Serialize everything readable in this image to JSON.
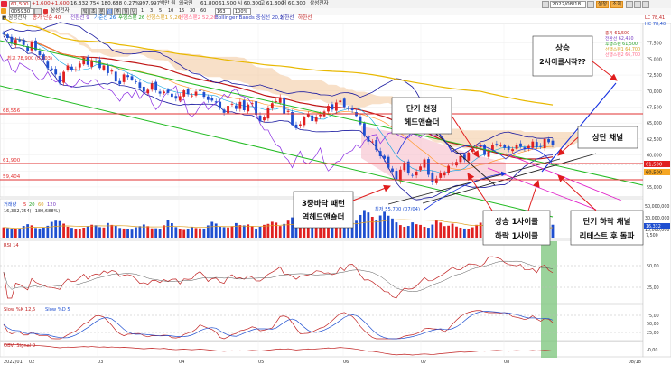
{
  "toolbar": {
    "price_cells": [
      "61,500",
      "+1,600",
      "+1,600",
      "16,332,754",
      "180,688",
      "0.27%",
      "997,997백만 원",
      "외국인",
      "61,800",
      "61,500",
      "시 60,300",
      "고 61,300",
      "저 60,300"
    ],
    "stock_name": "삼성전자",
    "code": "005930",
    "date": "2022/08/18",
    "period_tabs": [
      "틱",
      "초",
      "분",
      "일",
      "주",
      "월",
      "년"
    ],
    "numbers": [
      "1",
      "3",
      "5",
      "10",
      "15",
      "30",
      "60"
    ],
    "count": "163",
    "ratio": "100%",
    "right_buttons": [
      "설정",
      "조회"
    ],
    "legend": [
      "■ 삼성전자",
      "종가 단순 40",
      "전환선 9",
      "기준선 26",
      "후행스팬 26",
      "선행스팬1 9,26",
      "선행스팬2 52,26",
      "Bollinger Bands 중심선 20,2",
      "상한선",
      "하한선"
    ],
    "legend_colors": [
      "#3a3a3a",
      "#d21d1d",
      "#7a3fc4",
      "#0a6ae0",
      "#22a022",
      "#d8a020",
      "#ff6b8a",
      "#3040c0",
      "#1a1aa0",
      "#c02020"
    ]
  },
  "annotations": {
    "top_right_1": "상승",
    "top_right_2": "2사이클시작??",
    "mid_1": "단기 천정",
    "mid_2": "헤드앤숄더",
    "upper_channel": "상단 채널",
    "bottom_left_1": "3중바닥 패턴",
    "bottom_left_2": "역헤드앤숄더",
    "low_label": "최저 55,700 (07/04)",
    "high_label": "최고 78,900 (01/03)",
    "cycle_1": "상승 1사이클",
    "cycle_2": "하락 1사이클",
    "down_channel_1": "단기 하락 채널",
    "down_channel_2": "리테스트 후 돌파"
  },
  "y_labels_main": [
    "77,500",
    "75,000",
    "72,500",
    "70,000",
    "67,500",
    "65,000",
    "62,500",
    "60,000",
    "57,500",
    "55,000"
  ],
  "h_line_labels": [
    "68,556",
    "61,900",
    "59,404"
  ],
  "h_line_colors": [
    "#e23030",
    "#e23030",
    "#e23030"
  ],
  "current_price_label": "61,500",
  "current_price_label_2": "60,500",
  "right_top_labels": [
    "LC 78,41",
    "HC 78,40"
  ],
  "right_side_values": [
    "종가 61,500",
    "전환선 62,450",
    "후행스팬 61,500",
    "선행스팬1 64,700",
    "선행스팬2 66,700"
  ],
  "x_labels": [
    "2022/01",
    "02",
    "03",
    "04",
    "05",
    "06",
    "07",
    "08",
    "08/18"
  ],
  "volume": {
    "title": "거래량",
    "legend": [
      "5",
      "20",
      "60",
      "120"
    ],
    "info": "16,332,754(+180,688%)",
    "y_labels": [
      "50,000,000",
      "30,000,000",
      "10,000,000"
    ],
    "right_labels": [
      "16,332",
      "7,500"
    ]
  },
  "rsi": {
    "title": "RSI 14",
    "y_labels": [
      "50,00",
      "25,00"
    ]
  },
  "slow": {
    "title": "Slow %K 12,5",
    "title2": "Slow %D 5",
    "y_labels": [
      "75,00",
      "50,00",
      "25,00"
    ]
  },
  "macd": {
    "title": "OBV, Signal 9",
    "y_labels": [
      "-0,00"
    ]
  },
  "colors": {
    "up": "#e02020",
    "down": "#1f4fd0",
    "ichimoku_cloud": "#f3c69a",
    "bb_upper": "#1a1aa0",
    "ma40": "#c01616",
    "trend_green": "#22bb22",
    "trend_dark": "#222222",
    "trend_blue": "#1530e0",
    "magenta": "#e020c8",
    "highlight": "#7fc77f"
  },
  "chart_data": {
    "type": "candlestick",
    "period": "daily",
    "x_range": [
      "2022/01/03",
      "2022/08/18"
    ],
    "ylim": [
      54000,
      80000
    ],
    "ohlc_close_series": [
      78900,
      78300,
      77400,
      78000,
      77800,
      77200,
      76300,
      77600,
      76400,
      75600,
      74900,
      73600,
      73300,
      72600,
      71300,
      73000,
      74000,
      73300,
      73400,
      74300,
      75200,
      74100,
      74800,
      74700,
      73600,
      74000,
      72800,
      73200,
      71500,
      71100,
      72600,
      72200,
      71800,
      71400,
      70500,
      69900,
      70200,
      71200,
      70100,
      69600,
      69900,
      69700,
      69100,
      68800,
      69200,
      70100,
      69500,
      69300,
      69900,
      70000,
      69100,
      68600,
      68500,
      68200,
      67400,
      66600,
      67700,
      68000,
      67200,
      68300,
      67000,
      67900,
      68100,
      66300,
      65300,
      66000,
      67400,
      68100,
      68400,
      69000,
      66500,
      66900,
      64700,
      64200,
      64800,
      65900,
      66500,
      65300,
      65900,
      66300,
      66800,
      67700,
      67100,
      68200,
      68500,
      67500,
      67300,
      67000,
      66100,
      64800,
      63100,
      62100,
      62100,
      60800,
      59800,
      59400,
      58000,
      57400,
      56200,
      57700,
      58800,
      57100,
      56800,
      57400,
      58200,
      59300,
      56900,
      55700,
      56300,
      57100,
      57300,
      58300,
      58600,
      58900,
      59800,
      59300,
      60400,
      60900,
      61300,
      61400,
      60000,
      60800,
      61600,
      61700,
      61500,
      61100,
      60800,
      60900,
      61500,
      61300,
      60900,
      61400,
      62100,
      61200,
      61300,
      62500,
      62000,
      61500
    ],
    "volume_series": [
      13.0,
      12.1,
      11.3,
      10.4,
      12.0,
      14.8,
      17.0,
      15.6,
      12.2,
      11.6,
      13.1,
      15.0,
      19.9,
      21.5,
      20.9,
      17.7,
      13.8,
      12.4,
      11.0,
      10.8,
      12.6,
      14.3,
      16.3,
      15.7,
      13.2,
      12.8,
      18.5,
      16.1,
      15.4,
      12.2,
      11.5,
      11.3,
      10.1,
      13.1,
      14.5,
      16.6,
      14.5,
      11.7,
      11.8,
      10.7,
      15.6,
      22.6,
      18.3,
      13.3,
      11.1,
      9.7,
      10.6,
      13.4,
      12.1,
      11.7,
      11.5,
      15.5,
      20.0,
      17.8,
      14.3,
      13.2,
      12.8,
      14.6,
      18.4,
      15.9,
      15.5,
      16.7,
      14.7,
      11.5,
      13.9,
      16.2,
      17.4,
      20.1,
      19.0,
      14.7,
      17.3,
      21.5,
      25.6,
      21.4,
      15.4,
      14.6,
      13.2,
      16.3,
      15.3,
      13.5,
      12.9,
      18.1,
      21.6,
      22.5,
      17.9,
      15.4,
      14.3,
      18.8,
      21.4,
      28.6,
      34.9,
      31.8,
      26.3,
      22.6,
      28.0,
      32.7,
      27.7,
      24.2,
      19.3,
      15.9,
      13.7,
      14.8,
      19.3,
      17.0,
      16.1,
      13.7,
      12.5,
      16.5,
      21.9,
      19.0,
      14.6,
      15.1,
      17.7,
      14.0,
      12.6,
      11.5,
      10.6,
      13.1,
      16.2,
      18.9,
      15.1,
      11.6,
      11.3,
      10.4,
      9.6,
      11.2,
      13.0,
      14.2,
      12.6,
      10.4,
      8.9,
      9.7,
      12.0,
      14.6,
      13.5,
      11.1,
      10.0,
      16.3
    ],
    "horizontal_lines": [
      68556,
      61900,
      59404
    ],
    "high": {
      "value": 78900,
      "date": "01/03"
    },
    "low": {
      "value": 55700,
      "date": "07/04"
    },
    "indicators": [
      "SMA 40",
      "Ichimoku 9,26,52",
      "Bollinger Bands 20,2",
      "RSI 14",
      "Slow Stochastic 12,5,5",
      "OBV Signal 9"
    ]
  }
}
